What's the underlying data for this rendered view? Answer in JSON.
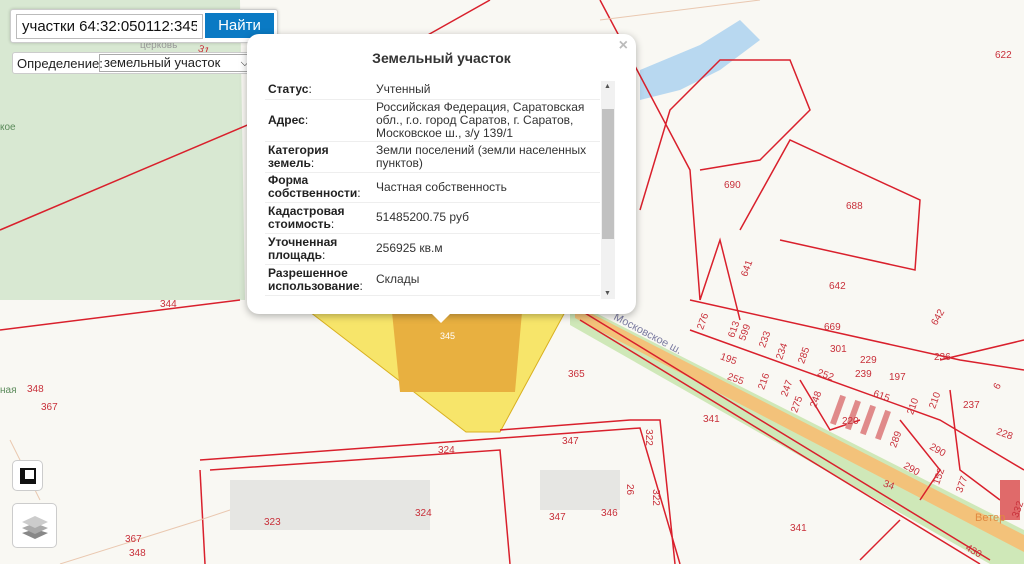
{
  "search": {
    "value": "участки 64:32:050112:345",
    "button": "Найти"
  },
  "definition": {
    "label": "Определение:",
    "selected": "земельный участок"
  },
  "popup": {
    "title": "Земельный участок",
    "rows": [
      {
        "label": "Статус",
        "value": "Учтенный"
      },
      {
        "label": "Адрес",
        "value": "Российская Федерация, Саратовская обл., г.о. город Саратов, г. Саратов, Московское ш., з/у 139/1"
      },
      {
        "label": "Категория земель",
        "value": "Земли поселений (земли населенных пунктов)"
      },
      {
        "label": "Форма собственности",
        "value": "Частная собственность"
      },
      {
        "label": "Кадастровая стоимость",
        "value": "51485200.75 руб"
      },
      {
        "label": "Уточненная площадь",
        "value": "256925 кв.м"
      },
      {
        "label": "Разрешенное использование",
        "value": "Склады"
      }
    ]
  },
  "map": {
    "colors": {
      "parcel_line": "#d9202c",
      "selected_parcel": "#f7e56a",
      "selected_building": "#e8b040",
      "road": "#f3c27a",
      "verge": "#cfe8b8",
      "park": "#d8e8d2"
    },
    "street": "Московское ш.",
    "poi": [
      "церковь",
      "кое",
      "ная",
      "Ветер"
    ],
    "labels": [
      "345",
      "344",
      "348",
      "367",
      "365",
      "341",
      "347",
      "324",
      "323",
      "324",
      "347",
      "346",
      "322",
      "322",
      "26",
      "341",
      "367",
      "348",
      "622",
      "690",
      "688",
      "641",
      "642",
      "642",
      "669",
      "276",
      "613",
      "599",
      "233",
      "234",
      "285",
      "301",
      "229",
      "239",
      "197",
      "236",
      "195",
      "255",
      "216",
      "247",
      "275",
      "248",
      "252",
      "615",
      "210",
      "210",
      "237",
      "6",
      "228",
      "220",
      "289",
      "290",
      "290",
      "152",
      "34",
      "377",
      "332",
      "430",
      "31"
    ]
  },
  "controls": {
    "ruler": "ruler-icon",
    "layers": "layers-icon"
  }
}
